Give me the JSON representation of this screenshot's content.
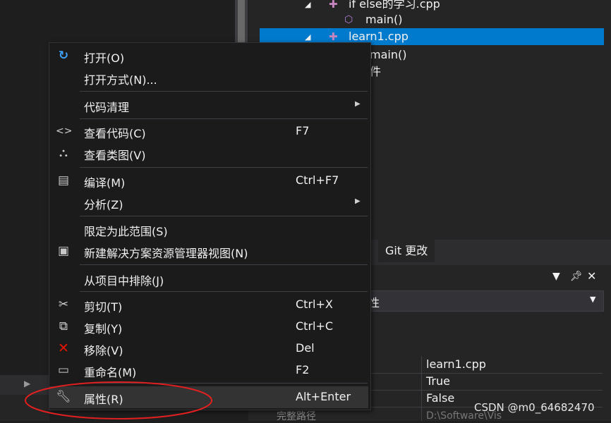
{
  "solution_explorer": {
    "rows": [
      {
        "label": "if else的学习.cpp"
      },
      {
        "label": "main()"
      },
      {
        "label": "learn1.cpp"
      },
      {
        "label": "main()"
      },
      {
        "label": "件"
      }
    ],
    "git_tab": "Git 更改"
  },
  "properties": {
    "combo_text": "性",
    "values": [
      "learn1.cpp",
      "True",
      "False"
    ],
    "cut_left": "完整路径",
    "cut_right": "D:\\Software\\Vis"
  },
  "context_menu": {
    "items": [
      {
        "label": "打开(O)",
        "shortcut": "",
        "icon": "open-arrow-icon"
      },
      {
        "label": "打开方式(N)...",
        "shortcut": ""
      },
      {
        "label": "代码清理",
        "shortcut": "",
        "submenu": true
      },
      {
        "label": "查看代码(C)",
        "shortcut": "F7",
        "icon": "code-brackets-icon"
      },
      {
        "label": "查看类图(V)",
        "shortcut": "",
        "icon": "class-diagram-icon"
      },
      {
        "label": "编译(M)",
        "shortcut": "Ctrl+F7",
        "icon": "compile-icon"
      },
      {
        "label": "分析(Z)",
        "shortcut": "",
        "submenu": true
      },
      {
        "label": "限定为此范围(S)",
        "shortcut": ""
      },
      {
        "label": "新建解决方案资源管理器视图(N)",
        "shortcut": "",
        "icon": "new-view-icon"
      },
      {
        "label": "从项目中排除(J)",
        "shortcut": ""
      },
      {
        "label": "剪切(T)",
        "shortcut": "Ctrl+X",
        "icon": "scissors-icon"
      },
      {
        "label": "复制(Y)",
        "shortcut": "Ctrl+C",
        "icon": "copy-icon"
      },
      {
        "label": "移除(V)",
        "shortcut": "Del",
        "icon": "remove-x-icon"
      },
      {
        "label": "重命名(M)",
        "shortcut": "F2",
        "icon": "rename-icon"
      },
      {
        "label": "属性(R)",
        "shortcut": "Alt+Enter",
        "icon": "wrench-icon"
      }
    ]
  },
  "watermark": "CSDN @m0_64682470",
  "colors": {
    "accent": "#007acc",
    "annotation": "#e02020",
    "remove_icon": "#e51400"
  }
}
